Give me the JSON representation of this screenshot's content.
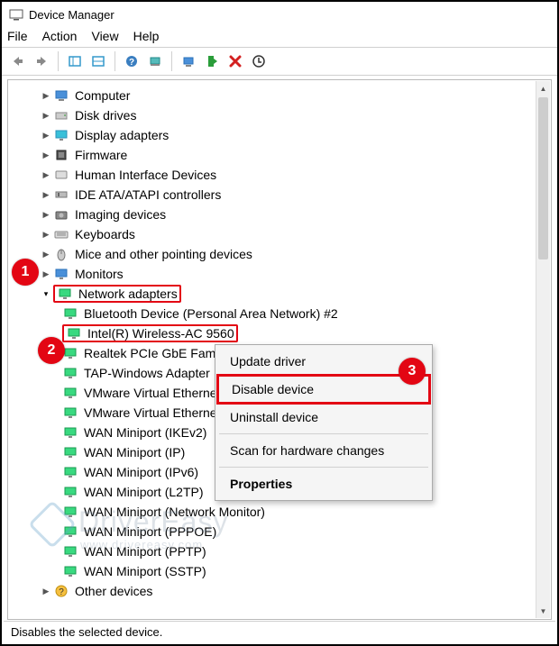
{
  "window": {
    "title": "Device Manager"
  },
  "menu": {
    "file": "File",
    "action": "Action",
    "view": "View",
    "help": "Help"
  },
  "tree": {
    "categories": [
      {
        "label": "Computer",
        "icon": "computer-icon"
      },
      {
        "label": "Disk drives",
        "icon": "disk-icon"
      },
      {
        "label": "Display adapters",
        "icon": "display-icon"
      },
      {
        "label": "Firmware",
        "icon": "firmware-icon"
      },
      {
        "label": "Human Interface Devices",
        "icon": "hid-icon"
      },
      {
        "label": "IDE ATA/ATAPI controllers",
        "icon": "ide-icon"
      },
      {
        "label": "Imaging devices",
        "icon": "imaging-icon"
      },
      {
        "label": "Keyboards",
        "icon": "keyboard-icon"
      },
      {
        "label": "Mice and other pointing devices",
        "icon": "mouse-icon"
      },
      {
        "label": "Monitors",
        "icon": "monitor-icon"
      },
      {
        "label": "Network adapters",
        "icon": "network-icon",
        "expanded": true,
        "children": [
          {
            "label": "Bluetooth Device (Personal Area Network) #2"
          },
          {
            "label": "Intel(R) Wireless-AC 9560",
            "selected": true
          },
          {
            "label": "Realtek PCIe GbE Famil"
          },
          {
            "label": "TAP-Windows Adapter"
          },
          {
            "label": "VMware Virtual Etherne"
          },
          {
            "label": "VMware Virtual Etherne"
          },
          {
            "label": "WAN Miniport (IKEv2)"
          },
          {
            "label": "WAN Miniport (IP)"
          },
          {
            "label": "WAN Miniport (IPv6)"
          },
          {
            "label": "WAN Miniport (L2TP)"
          },
          {
            "label": "WAN Miniport (Network Monitor)"
          },
          {
            "label": "WAN Miniport (PPPOE)"
          },
          {
            "label": "WAN Miniport (PPTP)"
          },
          {
            "label": "WAN Miniport (SSTP)"
          }
        ]
      },
      {
        "label": "Other devices",
        "icon": "other-icon"
      }
    ]
  },
  "context_menu": {
    "update": "Update driver",
    "disable": "Disable device",
    "uninstall": "Uninstall device",
    "scan": "Scan for hardware changes",
    "properties": "Properties"
  },
  "status": {
    "text": "Disables the selected device."
  },
  "callouts": {
    "one": "1",
    "two": "2",
    "three": "3"
  },
  "watermark": {
    "text": "DriverEasy",
    "sub": "www.drivereasy.com"
  }
}
